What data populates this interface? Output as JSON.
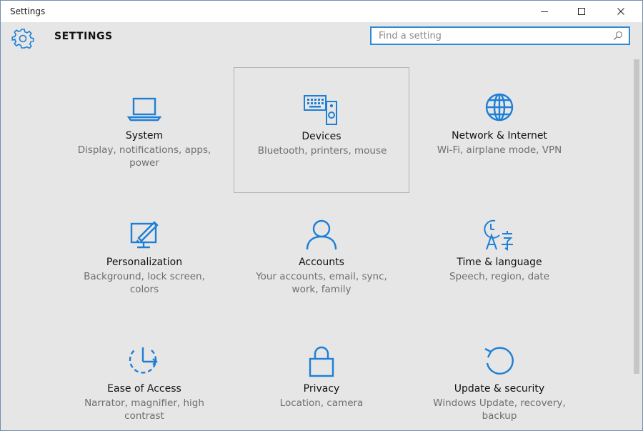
{
  "window": {
    "title": "Settings"
  },
  "header": {
    "heading": "SETTINGS",
    "search_placeholder": "Find a setting"
  },
  "colors": {
    "accent": "#1e7fd6",
    "background": "#e6e6e6",
    "description": "#6e6e6e"
  },
  "tiles": [
    {
      "name": "System",
      "desc": "Display, notifications, apps, power",
      "icon": "laptop-icon"
    },
    {
      "name": "Devices",
      "desc": "Bluetooth, printers, mouse",
      "icon": "devices-icon"
    },
    {
      "name": "Network & Internet",
      "desc": "Wi-Fi, airplane mode, VPN",
      "icon": "globe-icon"
    },
    {
      "name": "Personalization",
      "desc": "Background, lock screen, colors",
      "icon": "personalization-icon"
    },
    {
      "name": "Accounts",
      "desc": "Your accounts, email, sync, work, family",
      "icon": "person-icon"
    },
    {
      "name": "Time & language",
      "desc": "Speech, region, date",
      "icon": "time-language-icon"
    },
    {
      "name": "Ease of Access",
      "desc": "Narrator, magnifier, high contrast",
      "icon": "ease-of-access-icon"
    },
    {
      "name": "Privacy",
      "desc": "Location, camera",
      "icon": "lock-icon"
    },
    {
      "name": "Update & security",
      "desc": "Windows Update, recovery, backup",
      "icon": "update-icon"
    }
  ]
}
